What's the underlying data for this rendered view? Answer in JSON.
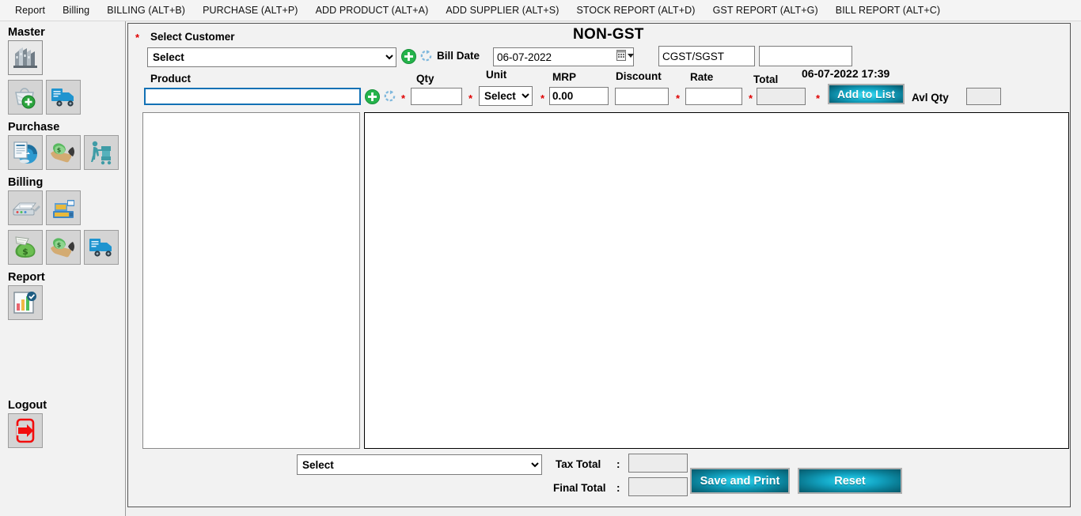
{
  "menu": {
    "items": [
      {
        "label": "Report",
        "name": "menu-report"
      },
      {
        "label": "Billing",
        "name": "menu-billing"
      },
      {
        "label": "BILLING (ALT+B)",
        "name": "menu-billing-alt-b"
      },
      {
        "label": "PURCHASE (ALT+P)",
        "name": "menu-purchase-alt-p"
      },
      {
        "label": "ADD PRODUCT (ALT+A)",
        "name": "menu-add-product-alt-a"
      },
      {
        "label": "ADD SUPPLIER (ALT+S)",
        "name": "menu-add-supplier-alt-s"
      },
      {
        "label": "STOCK REPORT (ALT+D)",
        "name": "menu-stock-report-alt-d"
      },
      {
        "label": "GST REPORT (ALT+G)",
        "name": "menu-gst-report-alt-g"
      },
      {
        "label": "BILL REPORT (ALT+C)",
        "name": "menu-bill-report-alt-c"
      }
    ]
  },
  "sidebar": {
    "groups": [
      {
        "heading": "Master",
        "icons": [
          "company-building-icon",
          "add-customer-icon",
          "supplier-truck-icon"
        ]
      },
      {
        "heading": "Purchase",
        "icons": [
          "purchase-order-icon",
          "purchase-payment-icon",
          "purchase-cart-icon"
        ]
      },
      {
        "heading": "Billing",
        "icons": [
          "billing-printer-icon",
          "cash-register-icon",
          "sales-money-bag-icon",
          "sales-payment-icon",
          "delivery-truck-icon"
        ]
      },
      {
        "heading": "Report",
        "icons": [
          "report-chart-icon"
        ]
      }
    ],
    "logout": {
      "heading": "Logout",
      "icon": "logout-door-arrow-icon"
    }
  },
  "form": {
    "title": "NON-GST",
    "required_marker": "*",
    "customer": {
      "label": "Select Customer",
      "value": "Select",
      "options": [
        "Select"
      ],
      "add_icon": "plus-circle-icon",
      "refresh_icon": "refresh-icon"
    },
    "bill_date": {
      "label": "Bill Date",
      "value": "06-07-2022",
      "picker_icon": "calendar-dropdown-icon"
    },
    "tax_type": {
      "value": "CGST/SGST"
    },
    "tax_extra": {
      "value": ""
    },
    "datetime_stamp": "06-07-2022  17:39",
    "product": {
      "label": "Product",
      "value": "",
      "add_icon": "plus-circle-icon",
      "refresh_icon": "refresh-icon"
    },
    "qty": {
      "label": "Qty",
      "value": ""
    },
    "unit": {
      "label": "Unit",
      "value": "Select",
      "options": [
        "Select"
      ]
    },
    "mrp": {
      "label": "MRP",
      "value": "0.00"
    },
    "discount": {
      "label": "Discount",
      "value": ""
    },
    "rate": {
      "label": "Rate",
      "value": ""
    },
    "total": {
      "label": "Total",
      "value": ""
    },
    "add_to_list": {
      "label": "Add to List"
    },
    "avl_qty": {
      "label": "Avl Qty",
      "value": ""
    }
  },
  "footer": {
    "payment_mode": {
      "value": "Select",
      "options": [
        "Select"
      ]
    },
    "tax_total": {
      "label": "Tax Total",
      "separator": ":",
      "value": ""
    },
    "final_total": {
      "label": "Final Total",
      "separator": ":",
      "value": ""
    },
    "save_and_print": {
      "label": "Save and Print"
    },
    "reset": {
      "label": "Reset"
    }
  },
  "colors": {
    "accent_cyan": "#13a7c6",
    "required_red": "#e00000",
    "panel_bg": "#f2f2f2",
    "focus_blue": "#1271b5"
  }
}
